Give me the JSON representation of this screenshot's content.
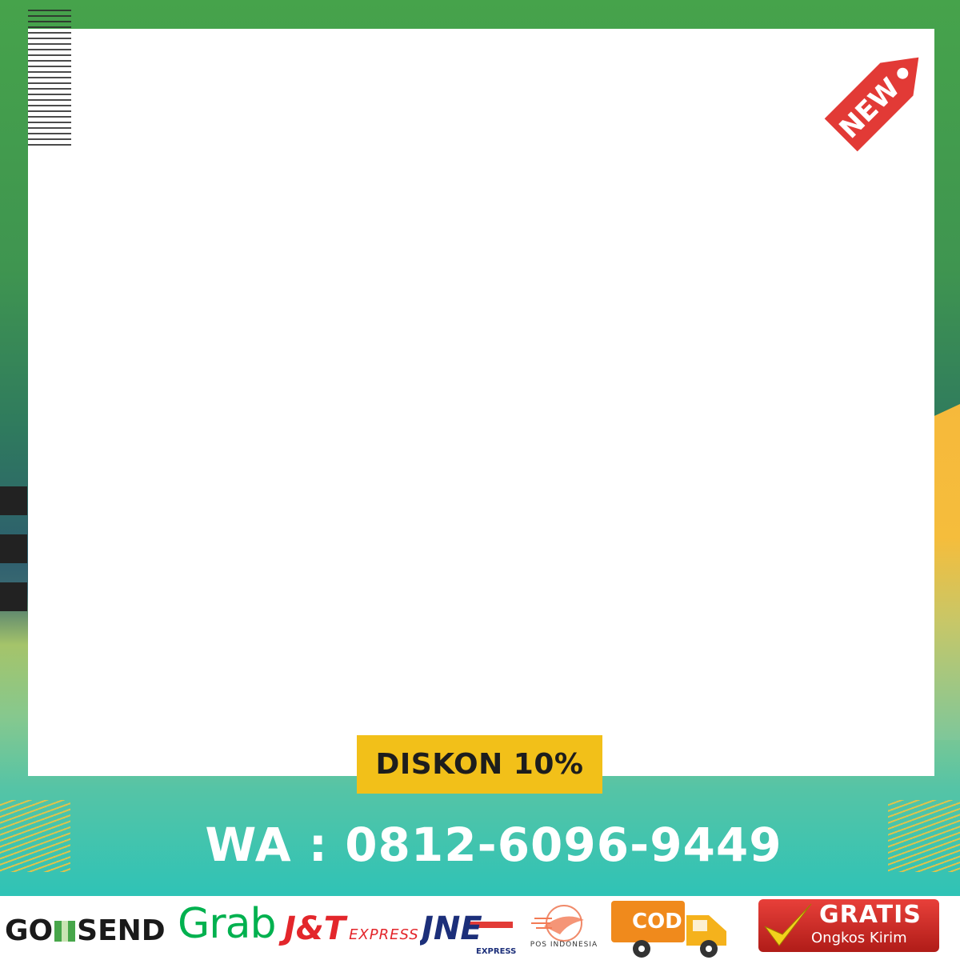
{
  "badge": {
    "new_label": "NEW"
  },
  "promo": {
    "discount_label": "DISKON 10%"
  },
  "contact": {
    "whatsapp_label": "WA : 0812-6096-9449"
  },
  "couriers": {
    "gosend": {
      "go": "GO",
      "send": "SEND"
    },
    "grab": "Grab",
    "jnt": {
      "main": "J&T",
      "sub": "EXPRESS"
    },
    "jne": {
      "main": "JNE",
      "sub": "EXPRESS"
    },
    "pos": "POS INDONESIA",
    "cod": "COD"
  },
  "gratis": {
    "title": "GRATIS",
    "subtitle": "Ongkos Kirim"
  },
  "colors": {
    "frame_green": "#46a34b",
    "accent_yellow": "#f2c019",
    "tag_red": "#e23a36",
    "teal": "#2fc3b6"
  }
}
